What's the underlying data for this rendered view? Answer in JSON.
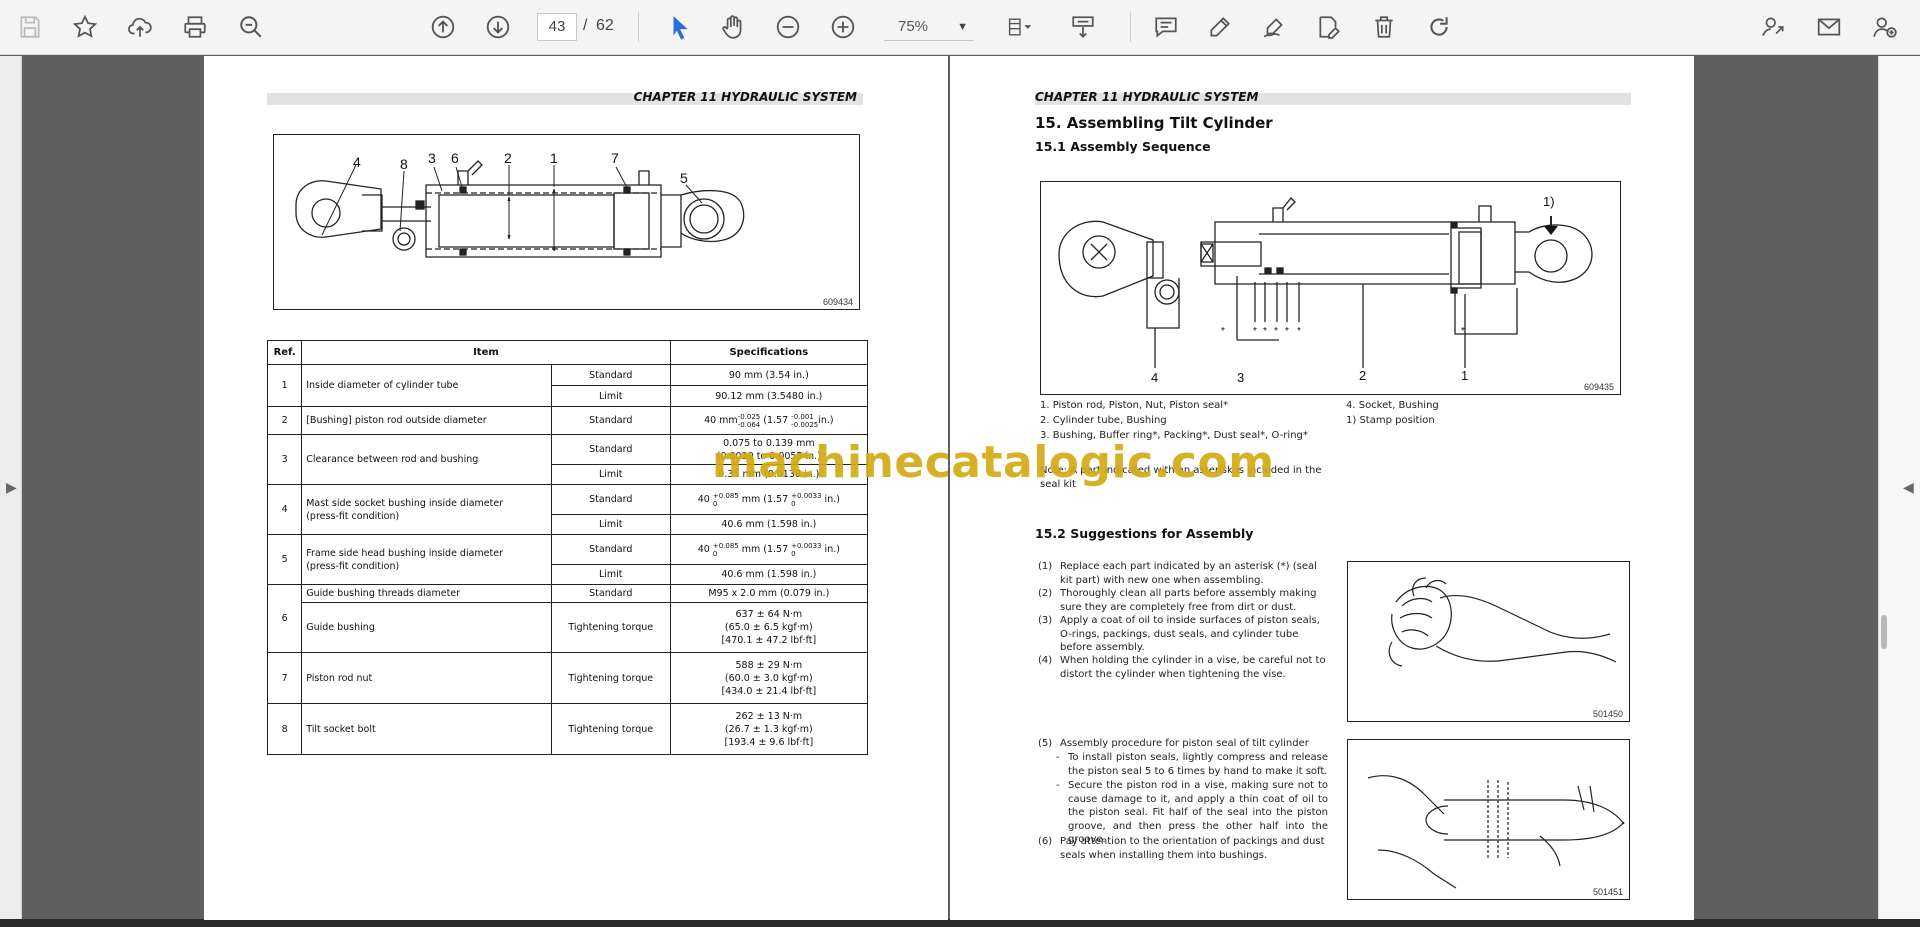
{
  "toolbar": {
    "page_current": "43",
    "page_separator": "/",
    "page_total": "62",
    "zoom": "75%"
  },
  "left_page": {
    "chapter_header": "CHAPTER 11 HYDRAULIC SYSTEM",
    "figure_callouts": [
      "4",
      "8",
      "3",
      "6",
      "2",
      "1",
      "7",
      "5"
    ],
    "figure_number": "609434",
    "table": {
      "headers": [
        "Ref.",
        "Item",
        "Specifications"
      ],
      "rows": [
        {
          "ref": "1",
          "item": "Inside diameter of cylinder tube",
          "sub": [
            [
              "Standard",
              "90 mm (3.54 in.)"
            ],
            [
              "Limit",
              "90.12 mm (3.5480 in.)"
            ]
          ]
        },
        {
          "ref": "2",
          "item": "[Bushing] piston rod outside diameter",
          "sub": [
            [
              "Standard",
              "40 mm -0.025/-0.064 (1.57 -0.001/-0.0025 in.)"
            ]
          ]
        },
        {
          "ref": "3",
          "item": "Clearance between rod and bushing",
          "sub": [
            [
              "Standard",
              "0.075 to 0.139 mm\n(0.0030 to 0.0055 in.)"
            ],
            [
              "Limit",
              "0.35 mm (0.0138 in.)"
            ]
          ]
        },
        {
          "ref": "4",
          "item": "Mast side socket bushing inside diameter\n(press-fit condition)",
          "sub": [
            [
              "Standard",
              "40 +0.085/0 mm (1.57 +0.0033/0 in.)"
            ],
            [
              "Limit",
              "40.6 mm (1.598 in.)"
            ]
          ]
        },
        {
          "ref": "5",
          "item": "Frame side head bushing inside diameter\n(press-fit condition)",
          "sub": [
            [
              "Standard",
              "40 +0.085/0 mm (1.57 +0.0033/0 in.)"
            ],
            [
              "Limit",
              "40.6 mm (1.598 in.)"
            ]
          ]
        },
        {
          "ref": "6",
          "item_a": "Guide bushing threads diameter",
          "item_b": "Guide bushing",
          "sub": [
            [
              "Standard",
              "M95 x 2.0 mm (0.079 in.)"
            ],
            [
              "Tightening torque",
              "637 ± 64 N·m\n(65.0 ± 6.5 kgf·m)\n[470.1 ± 47.2 lbf·ft]"
            ]
          ]
        },
        {
          "ref": "7",
          "item": "Piston rod nut",
          "sub": [
            [
              "Tightening torque",
              "588 ± 29 N·m\n(60.0 ± 3.0 kgf·m)\n[434.0 ± 21.4 lbf·ft]"
            ]
          ]
        },
        {
          "ref": "8",
          "item": "Tilt socket bolt",
          "sub": [
            [
              "Tightening torque",
              "262 ± 13 N·m\n(26.7 ± 1.3 kgf·m)\n[193.4 ± 9.6 lbf·ft]"
            ]
          ]
        }
      ]
    }
  },
  "right_page": {
    "chapter_header": "CHAPTER 11 HYDRAULIC SYSTEM",
    "section_title": "15.  Assembling Tilt Cylinder",
    "subsection_1": "15.1    Assembly Sequence",
    "figure_number": "609435",
    "figure_callouts": [
      "1)",
      "4",
      "3",
      "2",
      "1",
      "*",
      "*",
      "*",
      "*",
      "*",
      "*",
      "*"
    ],
    "captions_left": [
      "1.    Piston rod, Piston, Nut, Piston seal*",
      "2.    Cylinder tube, Bushing",
      "3.    Bushing, Buffer ring*, Packing*, Dust seal*, O-ring*"
    ],
    "captions_right": [
      "4.    Socket, Bushing",
      "1)    Stamp position"
    ],
    "note": "Note: A part indicated with an asterisk is included in the seal kit",
    "subsection_2": "15.2    Suggestions for Assembly",
    "steps": [
      {
        "n": "(1)",
        "text": "Replace each part indicated by an asterisk (*) (seal kit part) with new one when assembling."
      },
      {
        "n": "(2)",
        "text": "Thoroughly clean all parts before assembly making sure they are completely free from dirt or dust."
      },
      {
        "n": "(3)",
        "text": "Apply a coat of oil to inside surfaces of piston seals, O-rings, packings, dust seals, and cylinder tube before assembly."
      },
      {
        "n": "(4)",
        "text": "When holding the cylinder in a vise, be careful not to distort the cylinder when tightening the vise."
      }
    ],
    "step5": {
      "n": "(5)",
      "text": "Assembly procedure for piston seal of tilt cylinder"
    },
    "step5_bullets": [
      "To install piston seals, lightly compress and release the piston seal 5 to 6 times by hand to make it soft.",
      "Secure the piston rod in a vise, making sure not to cause damage to it, and apply a thin coat of oil to the piston seal. Fit half of the seal into the piston groove, and then press the other half into the groove."
    ],
    "step6": {
      "n": "(6)",
      "text": "Pay attention to the orientation of packings and dust seals when installing them into bushings."
    },
    "photo1_number": "501450",
    "photo2_number": "501451"
  },
  "watermark": "machinecatalogic.com"
}
